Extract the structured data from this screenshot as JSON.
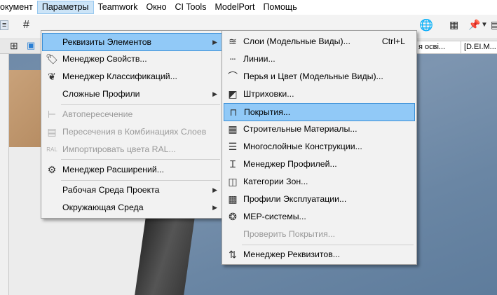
{
  "menubar": {
    "items": [
      "окумент",
      "Параметры",
      "Teamwork",
      "Окно",
      "CI Tools",
      "ModelPort",
      "Помощь"
    ],
    "active_index": 1
  },
  "tabs": [
    "я осві...",
    "[D.EI.M..."
  ],
  "menu_main": {
    "items": [
      {
        "label": "Реквизиты Элементов",
        "icon": "",
        "submenu": true,
        "disabled": false,
        "selected": true
      },
      {
        "label": "Менеджер Свойств...",
        "icon": "tag-icon",
        "submenu": false,
        "disabled": false
      },
      {
        "label": "Менеджер Классификаций...",
        "icon": "tree-icon",
        "submenu": false,
        "disabled": false
      },
      {
        "label": "Сложные Профили",
        "icon": "",
        "submenu": true,
        "disabled": false
      },
      {
        "label": "Автопересечение",
        "icon": "auto-intersect-icon",
        "submenu": false,
        "disabled": true
      },
      {
        "label": "Пересечения в Комбинациях Слоев",
        "icon": "layer-intersect-icon",
        "submenu": false,
        "disabled": true
      },
      {
        "label": "Импортировать цвета RAL...",
        "icon": "ral-icon",
        "submenu": false,
        "disabled": true
      },
      {
        "label": "Менеджер Расширений...",
        "icon": "extension-icon",
        "submenu": false,
        "disabled": false
      },
      {
        "label": "Рабочая Среда Проекта",
        "icon": "",
        "submenu": true,
        "disabled": false
      },
      {
        "label": "Окружающая Среда",
        "icon": "",
        "submenu": true,
        "disabled": false
      }
    ]
  },
  "menu_sub": {
    "items": [
      {
        "label": "Слои (Модельные Виды)...",
        "shortcut": "Ctrl+L",
        "icon": "layers-icon",
        "disabled": false
      },
      {
        "label": "Линии...",
        "icon": "lines-icon",
        "disabled": false
      },
      {
        "label": "Перья и Цвет (Модельные Виды)...",
        "icon": "pen-icon",
        "disabled": false
      },
      {
        "label": "Штриховки...",
        "icon": "hatch-icon",
        "disabled": false
      },
      {
        "label": "Покрытия...",
        "icon": "paint-roller-icon",
        "disabled": false,
        "highlighted": true
      },
      {
        "label": "Строительные Материалы...",
        "icon": "materials-icon",
        "disabled": false
      },
      {
        "label": "Многослойные Конструкции...",
        "icon": "multilayer-icon",
        "disabled": false
      },
      {
        "label": "Менеджер Профилей...",
        "icon": "profile-icon",
        "disabled": false
      },
      {
        "label": "Категории Зон...",
        "icon": "zone-icon",
        "disabled": false
      },
      {
        "label": "Профили Эксплуатации...",
        "icon": "schedule-icon",
        "disabled": false
      },
      {
        "label": "MEP-системы...",
        "icon": "mep-icon",
        "disabled": false
      },
      {
        "label": "Проверить Покрытия...",
        "icon": "",
        "disabled": true
      },
      {
        "label": "Менеджер Реквизитов...",
        "icon": "attribute-manager-icon",
        "disabled": false
      }
    ]
  }
}
